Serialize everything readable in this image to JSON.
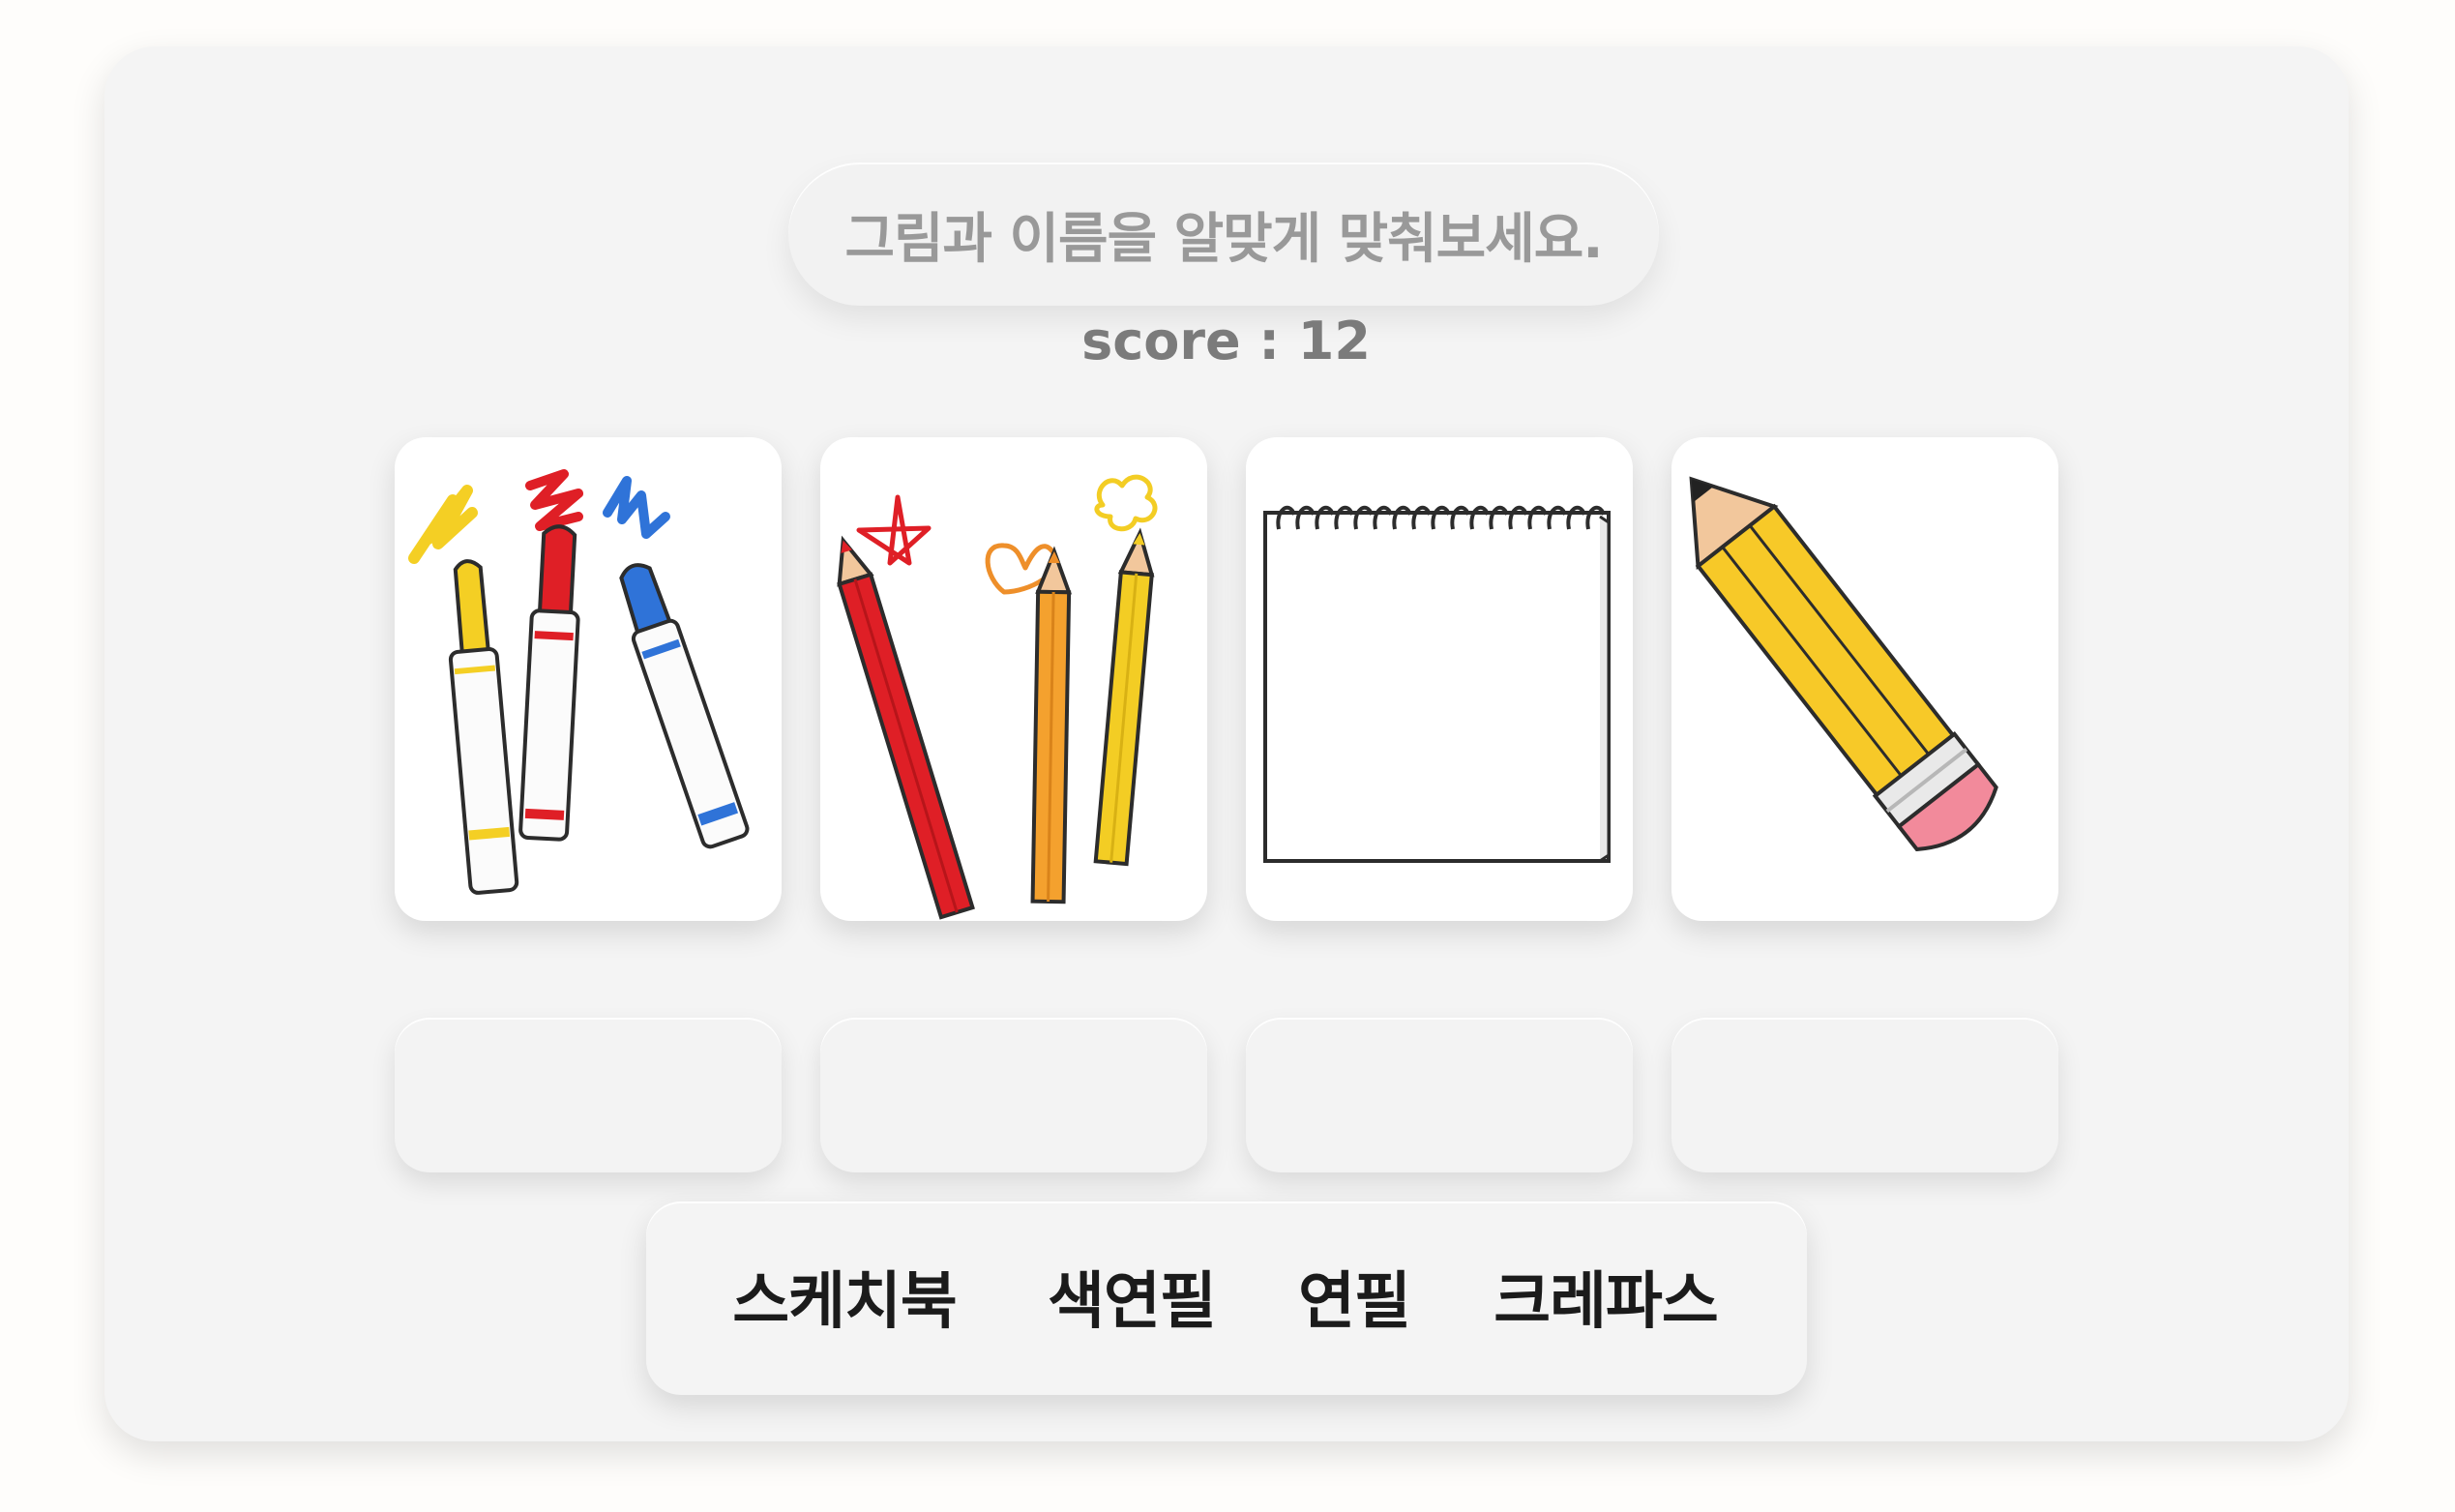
{
  "header": {
    "instruction": "그림과 이름을 알맞게 맞춰보세요.",
    "score_text": "score : 12"
  },
  "cards": [
    {
      "image": "crayons-icon"
    },
    {
      "image": "colored-pencils-icon"
    },
    {
      "image": "sketchbook-icon"
    },
    {
      "image": "pencil-icon"
    }
  ],
  "answer_slots": [
    "",
    "",
    "",
    ""
  ],
  "word_choices": [
    "스케치북",
    "색연필",
    "연필",
    "크레파스"
  ],
  "colors": {
    "background": "#fefdfb",
    "panel": "#f4f4f4",
    "instruction_text": "#999999",
    "score_text": "#7b7b7b",
    "word_text": "#1b1b1b"
  }
}
